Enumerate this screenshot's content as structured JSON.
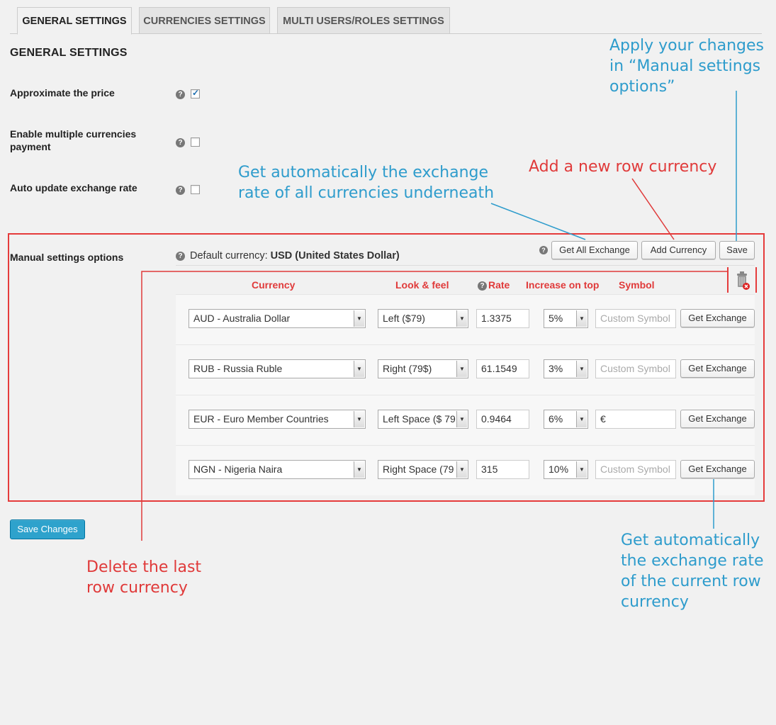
{
  "tabs": [
    {
      "label": "GENERAL SETTINGS"
    },
    {
      "label": "CURRENCIES SETTINGS"
    },
    {
      "label": "MULTI USERS/ROLES SETTINGS"
    }
  ],
  "section_title": "GENERAL SETTINGS",
  "help_glyph": "?",
  "options": {
    "approximate": {
      "label": "Approximate the price",
      "checked": true
    },
    "multi_payment": {
      "label_line1": "Enable multiple currencies",
      "label_line2": "payment",
      "checked": false
    },
    "auto_update": {
      "label": "Auto update exchange rate",
      "checked": false
    }
  },
  "manual": {
    "label": "Manual settings options",
    "default_prefix": "Default currency:",
    "default_value": "USD (United States Dollar)",
    "buttons": {
      "get_all": "Get All Exchange",
      "add_currency": "Add Currency",
      "save": "Save"
    },
    "columns": {
      "currency": "Currency",
      "look": "Look & feel",
      "rate": "Rate",
      "increase": "Increase on top",
      "symbol": "Symbol"
    },
    "symbol_placeholder": "Custom Symbol",
    "get_exchange": "Get Exchange",
    "rows": [
      {
        "currency": "AUD - Australia Dollar",
        "look": "Left ($79)",
        "rate": "1.3375",
        "increase": "5%",
        "symbol": ""
      },
      {
        "currency": "RUB - Russia Ruble",
        "look": "Right (79$)",
        "rate": "61.1549",
        "increase": "3%",
        "symbol": ""
      },
      {
        "currency": "EUR - Euro Member Countries",
        "look": "Left Space ($ 79",
        "rate": "0.9464",
        "increase": "6%",
        "symbol": "€"
      },
      {
        "currency": "NGN - Nigeria Naira",
        "look": "Right Space (79",
        "rate": "315",
        "increase": "10%",
        "symbol": ""
      }
    ]
  },
  "save_changes": "Save Changes",
  "annotations": {
    "apply": [
      "Apply your changes",
      "in “Manual settings",
      "options”"
    ],
    "get_all": [
      "Get automatically the exchange",
      "rate of all currencies underneath"
    ],
    "add_row": [
      "Add a new row currency"
    ],
    "delete_last": [
      "Delete the last",
      "row currency"
    ],
    "get_row": [
      "Get automatically",
      "the exchange rate",
      "of the current row",
      "currency"
    ]
  },
  "colors": {
    "annotation_blue": "#2e9ccc",
    "annotation_red": "#e03a3a",
    "primary_button": "#2ea2cc"
  }
}
